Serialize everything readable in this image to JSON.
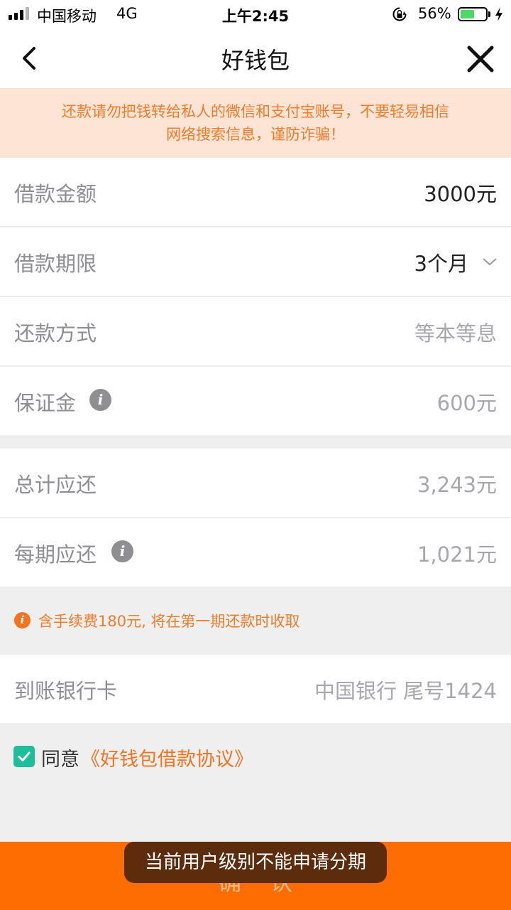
{
  "status_bar": {
    "carrier": "中国移动",
    "network": "4G",
    "time": "上午2:45",
    "battery": "56%",
    "battery_level": 0.56,
    "battery_color": "#4cd964"
  },
  "nav": {
    "title": "好钱包",
    "back_icon": "chevron-left-icon",
    "close_icon": "close-icon"
  },
  "notice": {
    "line1": "还款请勿把钱转给私人的微信和支付宝账号，不要轻易相信",
    "line2": "网络搜索信息，谨防诈骗！"
  },
  "loan": {
    "amount_label": "借款金额",
    "amount_value": "3000元",
    "term_label": "借款期限",
    "term_value": "3个月",
    "method_label": "还款方式",
    "method_value": "等本等息",
    "deposit_label": "保证金",
    "deposit_value": "600元"
  },
  "repay": {
    "total_label": "总计应还",
    "total_value": "3,243元",
    "per_period_label": "每期应还",
    "per_period_value": "1,021元"
  },
  "fee_notice": "含手续费180元, 将在第一期还款时收取",
  "bank": {
    "label": "到账银行卡",
    "value": "中国银行  尾号1424"
  },
  "agreement": {
    "checked": true,
    "agree_text": "同意",
    "link_text": "《好钱包借款协议》"
  },
  "confirm_label": "确认",
  "toast": "当前用户级别不能申请分期",
  "colors": {
    "accent": "#fe6d02",
    "notice_bg": "#fde4d4",
    "notice_text": "#f07c2a",
    "checkbox": "#1dbf9b"
  }
}
